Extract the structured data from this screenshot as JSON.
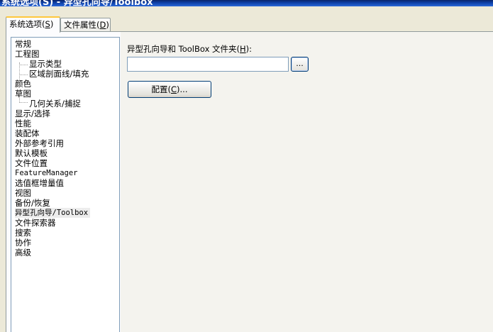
{
  "window": {
    "title": "系统选项(S) - 异型孔向导/Toolbox"
  },
  "tabs": [
    {
      "label": "系统选项(",
      "key": "S",
      "suffix": ")"
    },
    {
      "label": "文件属性(",
      "key": "D",
      "suffix": ")"
    }
  ],
  "tree": {
    "items": [
      "常规",
      "工程图",
      "显示类型",
      "区域剖面线/填充",
      "颜色",
      "草图",
      "几何关系/捕捉",
      "显示/选择",
      "性能",
      "装配体",
      "外部参考引用",
      "默认模板",
      "文件位置",
      "FeatureManager",
      "选值框增量值",
      "视图",
      "备份/恢复",
      "异型孔向导/Toolbox",
      "文件探索器",
      "搜索",
      "协作",
      "高级"
    ],
    "selected": "异型孔向导/Toolbox"
  },
  "panel": {
    "folder_label_prefix": "异型孔向导和 ToolBox 文件夹(",
    "folder_label_key": "H",
    "folder_label_suffix": "):",
    "folder_value": "",
    "browse_label": "...",
    "config_prefix": "配置(",
    "config_key": "C",
    "config_suffix": ")..."
  }
}
